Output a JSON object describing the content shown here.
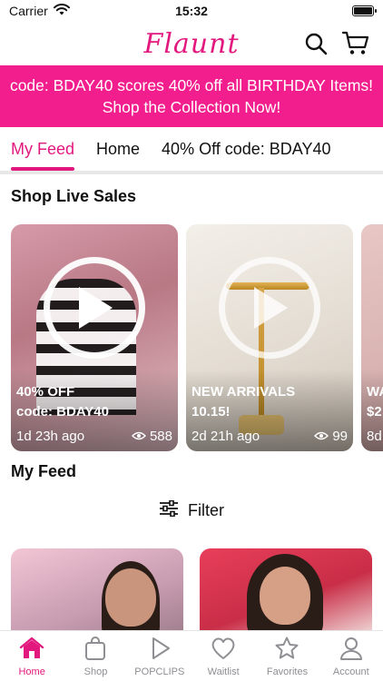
{
  "status_bar": {
    "carrier": "Carrier",
    "time": "15:32"
  },
  "header": {
    "logo_text": "Flaunt",
    "brand_color": "#e2187e",
    "icons": [
      "search-icon",
      "cart-icon"
    ]
  },
  "promo": {
    "line1": "code: BDAY40 scores 40% off all BIRTHDAY Items!",
    "line2": "Shop the Collection Now!",
    "background": "#f21e8d"
  },
  "tabs": [
    {
      "label": "My Feed",
      "active": true
    },
    {
      "label": "Home",
      "active": false
    },
    {
      "label": "40% Off code: BDAY40",
      "active": false
    }
  ],
  "live_sales": {
    "title": "Shop Live Sales",
    "cards": [
      {
        "title": "40% OFF\ncode: BDAY40",
        "age": "1d 23h ago",
        "views": "588"
      },
      {
        "title": "NEW ARRIVALS\n10.15!",
        "age": "2d 21h ago",
        "views": "99"
      },
      {
        "title": "WA\n$2",
        "age": "8d",
        "views": ""
      }
    ]
  },
  "my_feed": {
    "title": "My Feed",
    "filter_label": "Filter"
  },
  "tab_bar": {
    "items": [
      {
        "label": "Home",
        "icon": "home-icon",
        "active": true
      },
      {
        "label": "Shop",
        "icon": "bag-icon",
        "active": false
      },
      {
        "label": "POPCLIPS",
        "icon": "play-icon",
        "active": false
      },
      {
        "label": "Waitlist",
        "icon": "heart-icon",
        "active": false
      },
      {
        "label": "Favorites",
        "icon": "star-icon",
        "active": false
      },
      {
        "label": "Account",
        "icon": "person-icon",
        "active": false
      }
    ]
  }
}
